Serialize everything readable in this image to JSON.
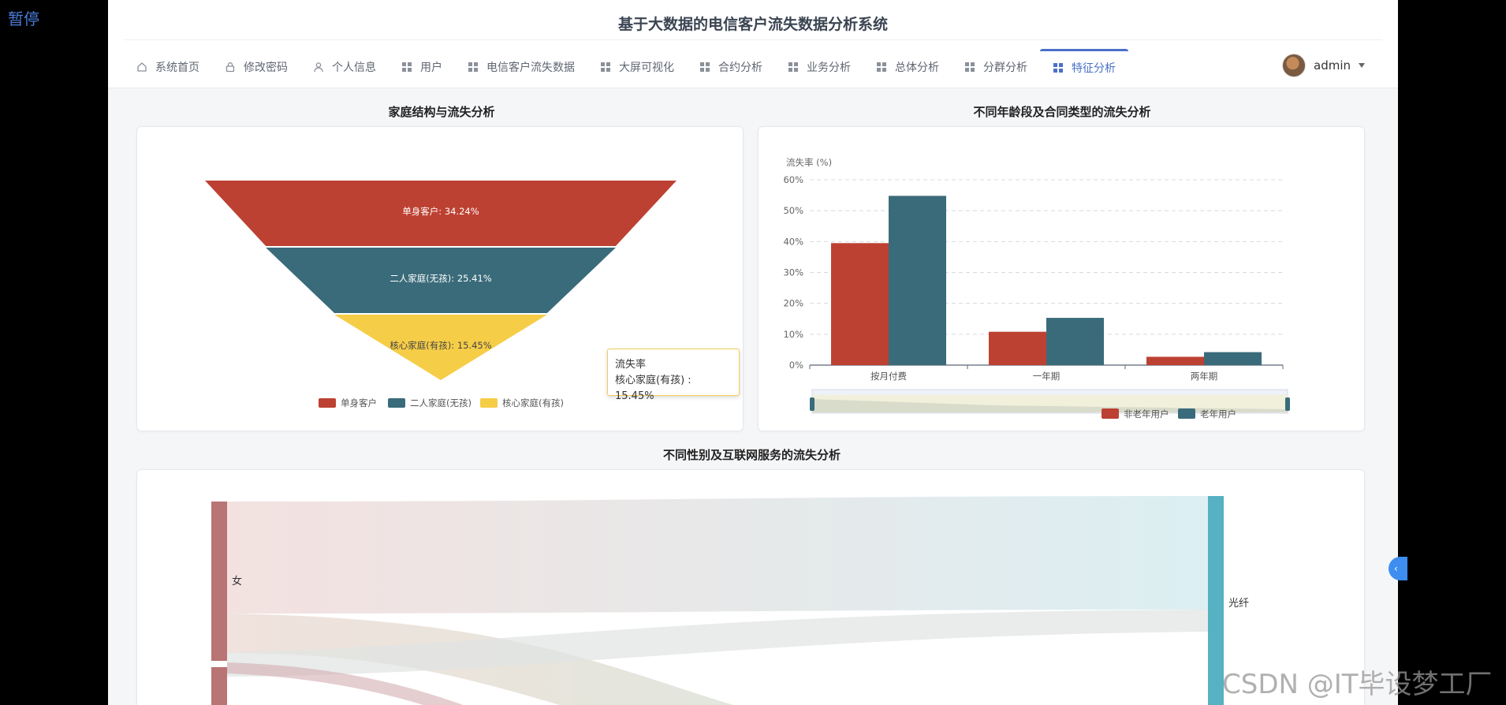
{
  "overlay": {
    "pause_label": "暂停",
    "watermark": "CSDN @IT毕设梦工厂"
  },
  "header": {
    "title": "基于大数据的电信客户流失数据分析系统"
  },
  "nav": {
    "items": [
      {
        "label": "系统首页",
        "icon": "home-icon"
      },
      {
        "label": "修改密码",
        "icon": "lock-icon"
      },
      {
        "label": "个人信息",
        "icon": "user-icon"
      },
      {
        "label": "用户",
        "icon": "grid-icon"
      },
      {
        "label": "电信客户流失数据",
        "icon": "grid-icon"
      },
      {
        "label": "大屏可视化",
        "icon": "grid-icon"
      },
      {
        "label": "合约分析",
        "icon": "grid-icon"
      },
      {
        "label": "业务分析",
        "icon": "grid-icon"
      },
      {
        "label": "总体分析",
        "icon": "grid-icon"
      },
      {
        "label": "分群分析",
        "icon": "grid-icon"
      },
      {
        "label": "特征分析",
        "icon": "grid-icon",
        "active": true
      }
    ]
  },
  "user": {
    "name": "admin"
  },
  "sections": {
    "family": "家庭结构与流失分析",
    "age_contract": "不同年龄段及合同类型的流失分析",
    "gender_internet": "不同性别及互联网服务的流失分析"
  },
  "tooltip": {
    "title": "流失率",
    "line": "核心家庭(有孩) : 15.45%"
  },
  "chart_data": [
    {
      "type": "funnel",
      "categories": [
        "单身客户",
        "二人家庭(无孩)",
        "核心家庭(有孩)"
      ],
      "values": [
        34.24,
        25.41,
        15.45
      ],
      "labels": [
        "单身客户: 34.24%",
        "二人家庭(无孩): 25.41%",
        "核心家庭(有孩): 15.45%"
      ],
      "colors": [
        "#bd4132",
        "#3a6b7a",
        "#f6cd47"
      ],
      "legend": [
        "单身客户",
        "二人家庭(无孩)",
        "核心家庭(有孩)"
      ],
      "legend_position": "bottom"
    },
    {
      "type": "bar",
      "categories": [
        "按月付费",
        "一年期",
        "两年期"
      ],
      "series": [
        {
          "name": "非老年用户",
          "values": [
            39.5,
            10.8,
            2.7
          ],
          "color": "#bd4132"
        },
        {
          "name": "老年用户",
          "values": [
            54.8,
            15.3,
            4.2
          ],
          "color": "#3a6b7a"
        }
      ],
      "ylabel": "流失率 (%)",
      "ylim": [
        0,
        60
      ],
      "yticks": [
        "0%",
        "10%",
        "20%",
        "30%",
        "40%",
        "50%",
        "60%"
      ],
      "grid": true,
      "legend_position": "bottom",
      "datazoom": true
    },
    {
      "type": "sankey",
      "nodes_visible": [
        "女",
        "光纤"
      ],
      "colors": {
        "female": "#b97474",
        "fiber": "#56b1c2"
      }
    }
  ]
}
